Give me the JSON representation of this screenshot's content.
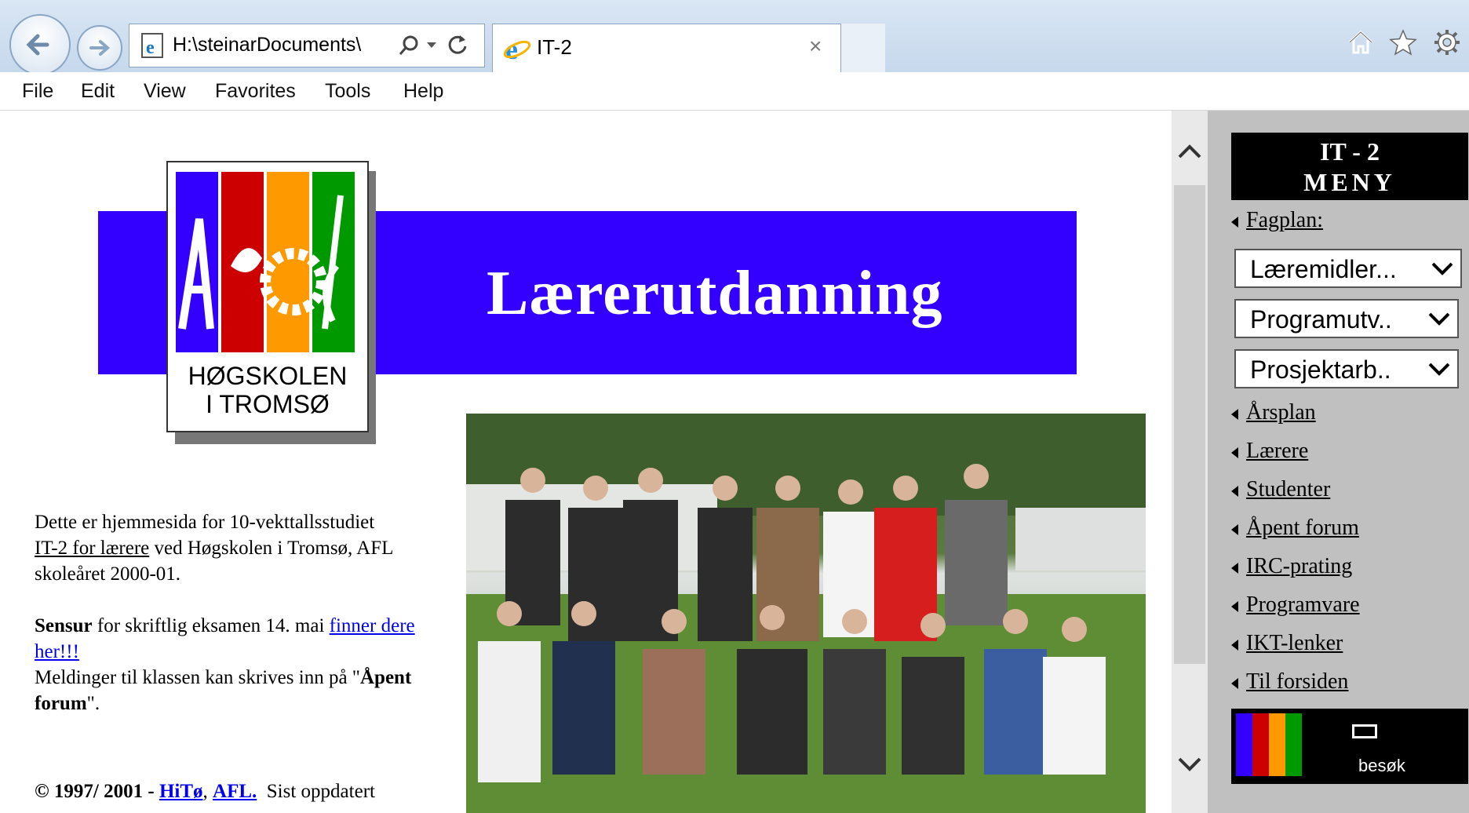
{
  "browser": {
    "address": "H:\\steinarDocuments\\it",
    "tab_title": "IT-2",
    "tab_close": "×"
  },
  "menubar": [
    "File",
    "Edit",
    "View",
    "Favorites",
    "Tools",
    "Help"
  ],
  "banner": {
    "title": "Lærerutdanning",
    "logo_line1": "HØGSKOLEN",
    "logo_line2": "I TROMSØ"
  },
  "intro": {
    "p1_a": "Dette er hjemmesida for 10-vekttallsstudiet",
    "p1_link": "IT-2 for lærere",
    "p1_b": "ved Høgskolen i Tromsø, AFL skoleåret 2000-01.",
    "p2_bold": "Sensur",
    "p2_a": "for skriftlig eksamen 14. mai",
    "p2_link": "finner dere her!!!",
    "p3_a": "Meldinger til klassen kan skrives inn på \"",
    "p3_bold": "Åpent forum",
    "p3_b": "\"."
  },
  "footer": {
    "copy": "© 1997/ 2001 -",
    "link1": "HiTø",
    "link2": "AFL.",
    "updated": "Sist oppdatert"
  },
  "sidebar": {
    "head_line1": "IT - 2",
    "head_line2": "MENY",
    "fagplan": "Fagplan:",
    "dropdowns": [
      "Læremidler...",
      "Programutv..",
      "Prosjektarb.."
    ],
    "links": [
      "Årsplan",
      "Lærere",
      "Studenter",
      "Åpent forum",
      "IRC-prating",
      "Programvare",
      "IKT-lenker",
      "Til forsiden"
    ],
    "visit": "besøk"
  },
  "colors": {
    "banner_blue": "#3300ff",
    "sidebar_gray": "#c0c0c0",
    "logo_stripes": [
      "#3300ff",
      "#cc0000",
      "#ff9900",
      "#009900"
    ]
  },
  "icons": [
    "back-icon",
    "forward-icon",
    "ie-page-icon",
    "search-icon",
    "refresh-icon",
    "ie-tab-icon",
    "home-icon",
    "favorites-star-icon",
    "settings-gear-icon",
    "scroll-up-icon",
    "scroll-down-icon"
  ]
}
